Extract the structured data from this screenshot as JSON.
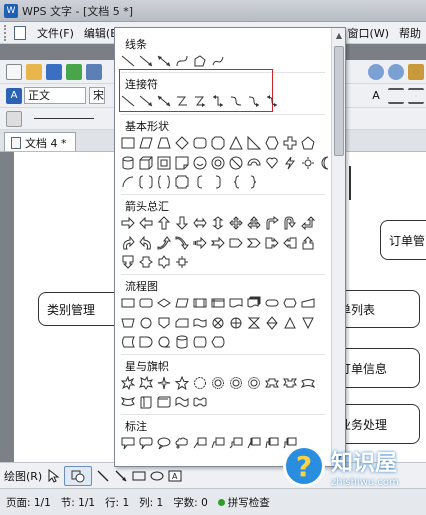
{
  "window": {
    "title": "WPS 文字 - [文档 5 *]"
  },
  "menu": {
    "items": [
      "文件(F)",
      "编辑(E)",
      "窗口(W)",
      "帮助"
    ]
  },
  "toolbar": {
    "style_value": "正文",
    "font_value": "宋"
  },
  "doc_tab": {
    "label": "文档 4 *"
  },
  "document": {
    "boxes": [
      "类别管理",
      "订单管",
      "单列表",
      "订单信息",
      "业务处理"
    ]
  },
  "shapes_menu": {
    "categories": [
      {
        "title": "线条"
      },
      {
        "title": "连接符"
      },
      {
        "title": "基本形状"
      },
      {
        "title": "箭头总汇"
      },
      {
        "title": "流程图"
      },
      {
        "title": "星与旗帜"
      },
      {
        "title": "标注"
      }
    ]
  },
  "drawbar": {
    "draw_label": "绘图(R)"
  },
  "status": {
    "page": "页面: 1/1",
    "section": "节: 1/1",
    "row": "行: 1",
    "col": "列: 1",
    "chars": "字数: 0",
    "spell": "拼写检查"
  },
  "watermark": {
    "cn": "知识屋",
    "en": "zhishiwu.com",
    "glyph": "?"
  }
}
